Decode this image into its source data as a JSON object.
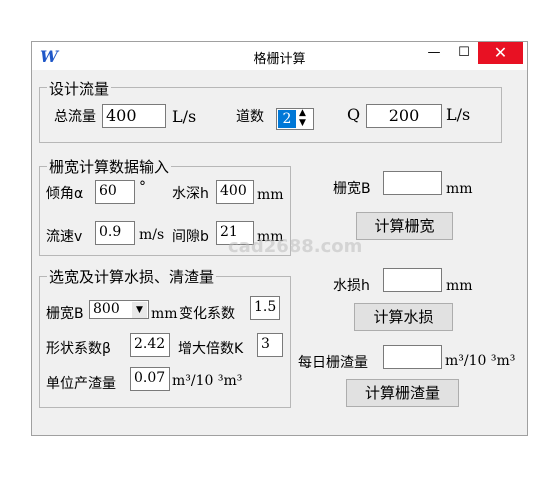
{
  "window": {
    "title": "格栅计算",
    "logo": "W",
    "minimize": "—",
    "maximize": "☐",
    "close": "✕"
  },
  "design_flow": {
    "legend": "设计流量",
    "total_flow_label": "总流量",
    "total_flow_value": "400",
    "flow_unit": "L/s",
    "channels_label": "道数",
    "channels_value": "2",
    "q_label": "Q",
    "q_value": "200",
    "q_unit": "L/s"
  },
  "width_input": {
    "legend": "栅宽计算数据输入",
    "angle_label": "倾角α",
    "angle_value": "60",
    "angle_unit": "°",
    "depth_label": "水深h",
    "depth_value": "400",
    "depth_unit": "mm",
    "velocity_label": "流速v",
    "velocity_value": "0.9",
    "velocity_unit": "m/s",
    "gap_label": "间隙b",
    "gap_value": "21",
    "gap_unit": "mm"
  },
  "width_calc": {
    "label": "栅宽B",
    "value": "",
    "unit": "mm",
    "button": "计算栅宽"
  },
  "loss_input": {
    "legend": "选宽及计算水损、清渣量",
    "width_label": "栅宽B",
    "width_value": "800",
    "width_unit": "mm",
    "coef_label": "变化系数",
    "coef_value": "1.5",
    "shape_label": "形状系数β",
    "shape_value": "2.42",
    "mult_label": "增大倍数K",
    "mult_value": "3",
    "unit_slag_label": "单位产渣量",
    "unit_slag_value": "0.07",
    "unit_slag_unit": "m³/10 ³m³"
  },
  "loss_calc": {
    "label": "水损h",
    "value": "",
    "unit": "mm",
    "button": "计算水损"
  },
  "slag_calc": {
    "label": "每日栅渣量",
    "value": "",
    "unit": "m³/10 ³m³",
    "button": "计算栅渣量"
  },
  "watermark": "cad2688.com"
}
